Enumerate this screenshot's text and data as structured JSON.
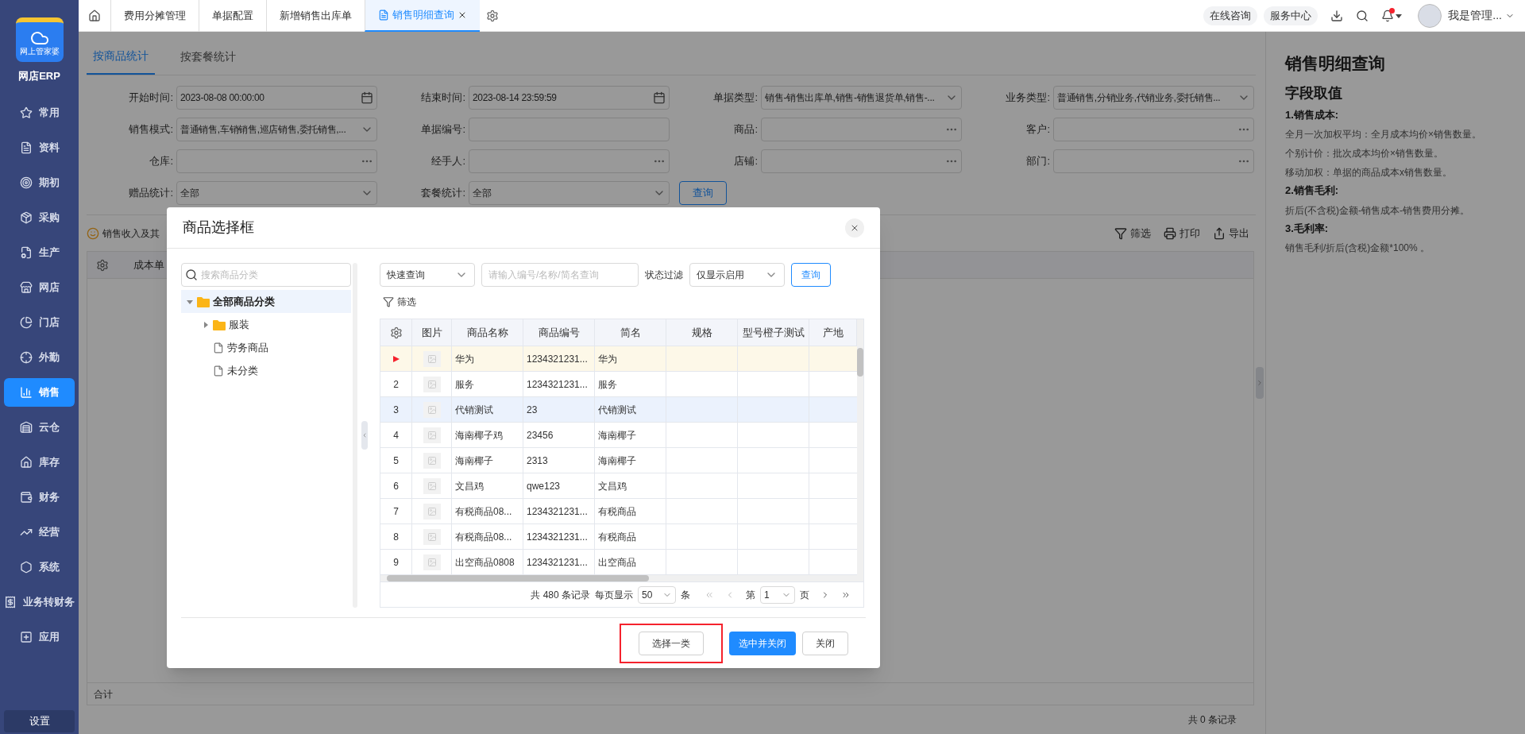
{
  "app": {
    "logo_text": "网上管家婆",
    "name": "网店ERP"
  },
  "sidebar": {
    "items": [
      {
        "label": "常用",
        "selected": false
      },
      {
        "label": "资料",
        "selected": false
      },
      {
        "label": "期初",
        "selected": false
      },
      {
        "label": "采购",
        "selected": false
      },
      {
        "label": "生产",
        "selected": false
      },
      {
        "label": "网店",
        "selected": false
      },
      {
        "label": "门店",
        "selected": false
      },
      {
        "label": "外勤",
        "selected": false
      },
      {
        "label": "销售",
        "selected": true
      },
      {
        "label": "云仓",
        "selected": false
      },
      {
        "label": "库存",
        "selected": false
      },
      {
        "label": "财务",
        "selected": false
      },
      {
        "label": "经营",
        "selected": false
      },
      {
        "label": "系统",
        "selected": false
      },
      {
        "label": "业务转财务",
        "selected": false
      },
      {
        "label": "应用",
        "selected": false
      }
    ],
    "settings": "设置"
  },
  "top_tabs": [
    {
      "label": "费用分摊管理",
      "selected": false
    },
    {
      "label": "单据配置",
      "selected": false
    },
    {
      "label": "新增销售出库单",
      "selected": false
    },
    {
      "label": "销售明细查询",
      "selected": true
    }
  ],
  "header_actions": {
    "buttons": [
      "在线咨询",
      "服务中心"
    ],
    "notification_unread": true,
    "user": "我是管理..."
  },
  "page_tabs": [
    {
      "label": "按商品统计",
      "selected": true
    },
    {
      "label": "按套餐统计",
      "selected": false
    }
  ],
  "filters": [
    {
      "label": "开始时间:",
      "value": "2023-08-08 00:00:00",
      "kind": "date"
    },
    {
      "label": "结束时间:",
      "value": "2023-08-14 23:59:59",
      "kind": "date"
    },
    {
      "label": "单据类型:",
      "value": "销售-销售出库单,销售-销售退货单,销售-...",
      "kind": "select"
    },
    {
      "label": "业务类型:",
      "value": "普通销售,分销业务,代销业务,委托销售...",
      "kind": "select"
    },
    {
      "label": "销售模式:",
      "value": "普通销售,车销销售,巡店销售,委托销售,...",
      "kind": "select"
    },
    {
      "label": "单据编号:",
      "kind": "text"
    },
    {
      "label": "商品:",
      "kind": "picker"
    },
    {
      "label": "客户:",
      "kind": "picker"
    },
    {
      "label": "仓库:",
      "kind": "picker"
    },
    {
      "label": "经手人:",
      "kind": "picker"
    },
    {
      "label": "店铺:",
      "kind": "picker"
    },
    {
      "label": "部门:",
      "kind": "picker"
    },
    {
      "label": "赠品统计:",
      "value": "全部",
      "kind": "select"
    },
    {
      "label": "套餐统计:",
      "value": "全部",
      "kind": "select"
    }
  ],
  "query_button": "查询",
  "summary": "销售收入及其",
  "toolbar": [
    "筛选",
    "打印",
    "导出"
  ],
  "table": {
    "columns": [
      "成本单"
    ],
    "total_label": "合计",
    "record_count": "共 0 条记录"
  },
  "help": {
    "title": "销售明细查询",
    "subtitle": "字段取值",
    "sections": [
      {
        "heading": "1.销售成本:",
        "lines": [
          "全月一次加权平均：全月成本均价×销售数量。",
          "个别计价：批次成本均价×销售数量。",
          "移动加权：单据的商品成本x销售数量。"
        ]
      },
      {
        "heading": "2.销售毛利:",
        "lines": [
          "折后(不含税)金额-销售成本-销售费用分摊。"
        ]
      },
      {
        "heading": "3.毛利率:",
        "lines": [
          "销售毛利/折后(含税)金额*100% 。"
        ]
      }
    ]
  },
  "dialog": {
    "title": "商品选择框",
    "tree": {
      "search_placeholder": "搜索商品分类",
      "nodes": [
        {
          "label": "全部商品分类",
          "kind": "folder",
          "expanded": true,
          "selected": true,
          "children": [
            {
              "label": "服装",
              "kind": "folder",
              "expanded": false,
              "selected": false
            },
            {
              "label": "劳务商品",
              "kind": "file",
              "selected": false
            },
            {
              "label": "未分类",
              "kind": "file",
              "selected": false
            }
          ]
        }
      ]
    },
    "query": {
      "mode": "快速查询",
      "placeholder": "请输入编号/名称/简名查询",
      "status_label": "状态过滤",
      "status": "仅显示启用",
      "button": "查询",
      "filter": "筛选"
    },
    "columns": [
      "图片",
      "商品名称",
      "商品编号",
      "简名",
      "规格",
      "型号橙子测试",
      "产地"
    ],
    "rows": [
      {
        "name": "华为",
        "code": "1234321231...",
        "short": "华为",
        "selected": true,
        "hovered": false
      },
      {
        "index": "2",
        "name": "服务",
        "code": "1234321231...",
        "short": "服务",
        "selected": false,
        "hovered": false
      },
      {
        "index": "3",
        "name": "代销测试",
        "code": "23",
        "short": "代销测试",
        "selected": false,
        "hovered": true
      },
      {
        "index": "4",
        "name": "海南椰子鸡",
        "code": "23456",
        "short": "海南椰子",
        "selected": false,
        "hovered": false
      },
      {
        "index": "5",
        "name": "海南椰子",
        "code": "2313",
        "short": "海南椰子",
        "selected": false,
        "hovered": false
      },
      {
        "index": "6",
        "name": "文昌鸡",
        "code": "qwe123",
        "short": "文昌鸡",
        "selected": false,
        "hovered": false
      },
      {
        "index": "7",
        "name": "有税商品08...",
        "code": "1234321231...",
        "short": "有税商品",
        "selected": false,
        "hovered": false
      },
      {
        "index": "8",
        "name": "有税商品08...",
        "code": "1234321231...",
        "short": "有税商品",
        "selected": false,
        "hovered": false
      },
      {
        "index": "9",
        "name": "出空商品0808",
        "code": "1234321231...",
        "short": "出空商品",
        "selected": false,
        "hovered": false
      }
    ],
    "pager": {
      "total": "共 480 条记录",
      "per_page_label": "每页显示",
      "per_page": "50",
      "unit": "条",
      "page_prefix": "第",
      "page": "1",
      "page_suffix": "页"
    },
    "buttons": [
      {
        "label": "选择一类",
        "kind": "default",
        "annotated": true
      },
      {
        "label": "选中并关闭",
        "kind": "primary",
        "annotated": false
      },
      {
        "label": "关闭",
        "kind": "default",
        "annotated": false
      }
    ]
  }
}
